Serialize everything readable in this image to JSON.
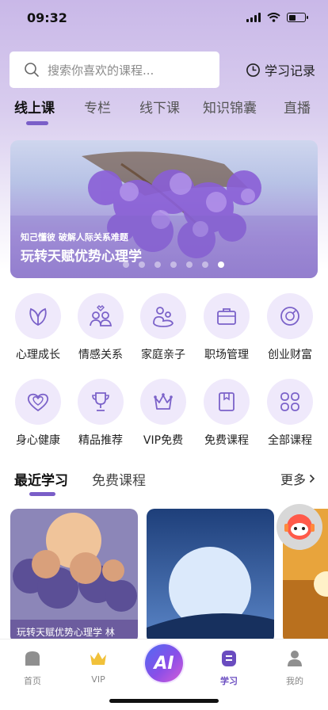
{
  "status": {
    "time": "09:32"
  },
  "search": {
    "placeholder": "搜索你喜欢的课程..."
  },
  "history": {
    "label": "学习记录"
  },
  "tabs": [
    "线上课",
    "专栏",
    "线下课",
    "知识锦囊",
    "直播"
  ],
  "banner": {
    "subtitle": "知己懂彼 破解人际关系难题",
    "title": "玩转天赋优势心理学",
    "dots": 7,
    "active_dot": 6
  },
  "categories": [
    {
      "label": "心理成长",
      "icon": "leaf-icon"
    },
    {
      "label": "情感关系",
      "icon": "couple-icon"
    },
    {
      "label": "家庭亲子",
      "icon": "family-icon"
    },
    {
      "label": "职场管理",
      "icon": "briefcase-icon"
    },
    {
      "label": "创业财富",
      "icon": "coin-icon"
    },
    {
      "label": "身心健康",
      "icon": "heart-icon"
    },
    {
      "label": "精品推荐",
      "icon": "trophy-icon"
    },
    {
      "label": "VIP免费",
      "icon": "crown-icon"
    },
    {
      "label": "免费课程",
      "icon": "book-icon"
    },
    {
      "label": "全部课程",
      "icon": "grid-icon"
    }
  ],
  "section": {
    "tabs": [
      "最近学习",
      "免费课程"
    ],
    "more": "更多"
  },
  "cards": [
    {
      "caption": "玩转天赋优势心理学 林"
    },
    {
      "caption": ""
    },
    {
      "caption": ""
    }
  ],
  "tabbar": {
    "items": [
      "首页",
      "VIP",
      "学习",
      "我的"
    ],
    "ai": "AI"
  },
  "colors": {
    "accent": "#7a5ec8",
    "icon": "#7b62c9"
  }
}
